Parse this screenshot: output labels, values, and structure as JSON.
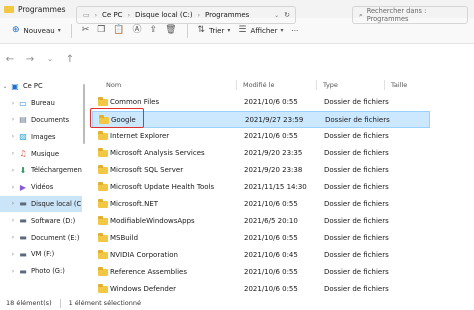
{
  "window": {
    "title": "Programmes"
  },
  "toolbar": {
    "new_label": "Nouveau",
    "sort_label": "Trier",
    "view_label": "Afficher",
    "more_label": "···"
  },
  "address": {
    "segments": [
      "Ce PC",
      "Disque local (C:)",
      "Programmes"
    ],
    "search_placeholder": "Rechercher dans : Programmes"
  },
  "sidebar": {
    "items": [
      {
        "label": "Ce PC",
        "icon": "pc-icon",
        "glyph": "🖥",
        "expanded": true
      },
      {
        "label": "Bureau",
        "icon": "desktop-icon",
        "glyph": "▭"
      },
      {
        "label": "Documents",
        "icon": "documents-icon",
        "glyph": "📄"
      },
      {
        "label": "Images",
        "icon": "images-icon",
        "glyph": "🖼"
      },
      {
        "label": "Musique",
        "icon": "music-icon",
        "glyph": "♫"
      },
      {
        "label": "Téléchargemen",
        "icon": "downloads-icon",
        "glyph": "⬇"
      },
      {
        "label": "Vidéos",
        "icon": "videos-icon",
        "glyph": "🎞"
      },
      {
        "label": "Disque local (C",
        "icon": "drive-icon",
        "glyph": "▬",
        "selected": true
      },
      {
        "label": "Software (D:)",
        "icon": "drive-icon",
        "glyph": "▬"
      },
      {
        "label": "Document (E:)",
        "icon": "drive-icon",
        "glyph": "▬"
      },
      {
        "label": "VM (F:)",
        "icon": "drive-icon",
        "glyph": "▬"
      },
      {
        "label": "Photo (G:)",
        "icon": "drive-icon",
        "glyph": "▬"
      }
    ]
  },
  "columns": {
    "name": "Nom",
    "modified": "Modifié le",
    "type": "Type",
    "size": "Taille"
  },
  "files": [
    {
      "name": "Common Files",
      "date": "2021/10/6 0:55",
      "type": "Dossier de fichiers"
    },
    {
      "name": "Google",
      "date": "2021/9/27 23:59",
      "type": "Dossier de fichiers",
      "selected": true
    },
    {
      "name": "Internet Explorer",
      "date": "2021/10/6 0:55",
      "type": "Dossier de fichiers"
    },
    {
      "name": "Microsoft Analysis Services",
      "date": "2021/9/20 23:35",
      "type": "Dossier de fichiers"
    },
    {
      "name": "Microsoft SQL Server",
      "date": "2021/9/20 23:38",
      "type": "Dossier de fichiers"
    },
    {
      "name": "Microsoft Update Health Tools",
      "date": "2021/11/15 14:30",
      "type": "Dossier de fichiers"
    },
    {
      "name": "Microsoft.NET",
      "date": "2021/10/6 0:55",
      "type": "Dossier de fichiers"
    },
    {
      "name": "ModifiableWindowsApps",
      "date": "2021/6/5 20:10",
      "type": "Dossier de fichiers"
    },
    {
      "name": "MSBuild",
      "date": "2021/10/6 0:55",
      "type": "Dossier de fichiers"
    },
    {
      "name": "NVIDIA Corporation",
      "date": "2021/10/6 0:45",
      "type": "Dossier de fichiers"
    },
    {
      "name": "Reference Assemblies",
      "date": "2021/10/6 0:55",
      "type": "Dossier de fichiers"
    },
    {
      "name": "Windows Defender",
      "date": "2021/10/6 0:55",
      "type": "Dossier de fichiers"
    }
  ],
  "status": {
    "count": "18 élément(s)",
    "selection": "1 élément sélectionné"
  },
  "colors": {
    "accent": "#1f6fd1",
    "folder": "#f2c744",
    "selection": "#cce8ff",
    "highlight_box": "#e03030"
  }
}
